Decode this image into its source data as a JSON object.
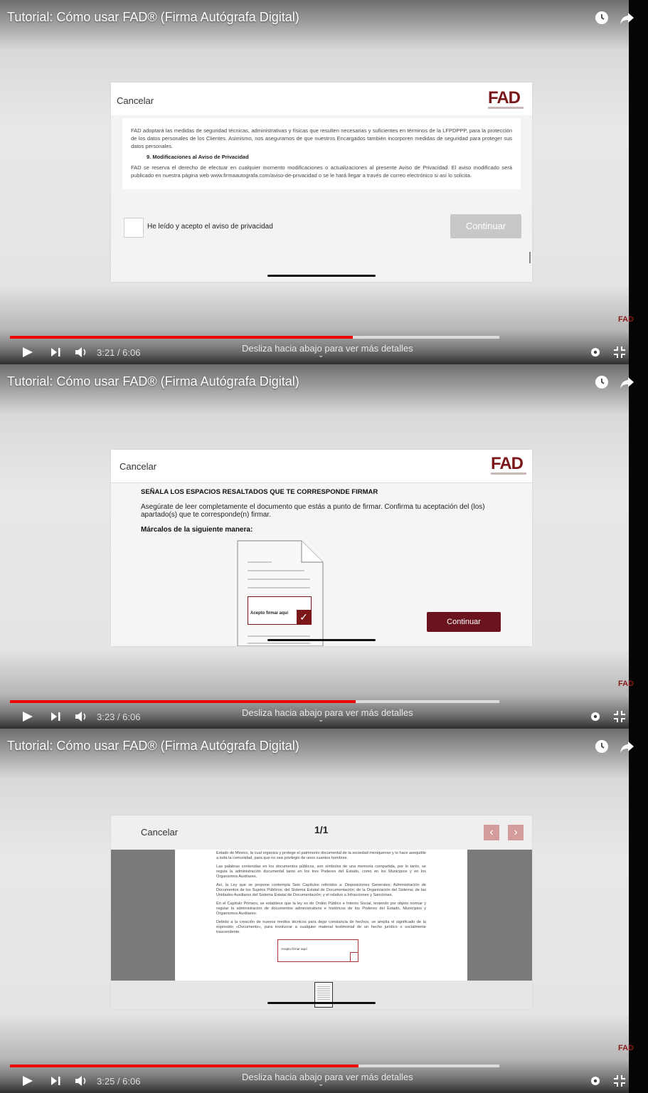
{
  "video": {
    "title": "Tutorial: Cómo usar FAD® (Firma Autógrafa Digital)",
    "watermark": "FAD",
    "hint": "Desliza hacia abajo para ver más detalles",
    "accent": "#e00000",
    "frames": [
      {
        "time": "3:21 / 6:06",
        "progress": 0.72,
        "loaded": 1.0
      },
      {
        "time": "3:23 / 6:06",
        "progress": 0.7,
        "loaded": 1.0
      },
      {
        "time": "3:25 / 6:06",
        "progress": 0.71,
        "loaded": 1.0
      }
    ]
  },
  "icons": {
    "clock": "clock-icon",
    "share": "share-icon",
    "play": "play-icon",
    "next": "next-icon",
    "volume": "volume-icon",
    "settings": "gear-icon",
    "exit_fullscreen": "exit-fullscreen-icon"
  },
  "screen1": {
    "cancel": "Cancelar",
    "logo": "FAD",
    "para1": "FAD adoptará las medidas de seguridad técnicas, administrativas y físicas que resulten necesarias y suficientes en términos de la LFPDPPP, para la protección de los datos personales de los Clientes. Asimismo, nos aseguramos de que nuestros Encargados también incorporen medidas de seguridad para proteger sus datos personales.",
    "section": "9.      Modificaciones al Aviso de Privacidad",
    "para2": "FAD se reserva el derecho de efectuar en cualquier momento modificaciones o actualizaciones al presente Aviso de Privacidad. El aviso modificado será publicado en nuestra página web www.firmaautografa.com/aviso-de-privacidad o se le hará llegar a través de correo electrónico si así lo solicita.",
    "checkbox_label": "He leído y acepto el aviso de privacidad",
    "continue": "Continuar"
  },
  "screen2": {
    "cancel": "Cancelar",
    "logo": "FAD",
    "heading": "SEÑALA LOS ESPACIOS RESALTADOS QUE TE CORRESPONDE FIRMAR",
    "body": "Asegúrate de leer completamente el documento que estás a punto de firmar. Confirma tu aceptación del (los) apartado(s) que te corresponde(n) firmar.",
    "mark_label": "Márcalos de la siguiente manera:",
    "accept_box": "Acepto firmar aquí",
    "continue": "Continuar"
  },
  "screen3": {
    "cancel": "Cancelar",
    "page": "1/1",
    "doc_paragraphs": [
      "Estado de México, la cual organiza y protege el patrimonio documental de la sociedad mexiquense y lo hace asequible a toda la comunidad, para que no sea privilegio de unos cuantos hombres.",
      "Las palabras contenidas en los documentos públicos, son símbolos de una memoria compartida, por lo tanto, se regula la administración documental tanto en los tres Poderes del Estado, como en los Municipios y en los Organismos Auxiliares.",
      "Así, la Ley que se propone contempla Seis Capítulos referidos a: Disposiciones Generales; Administración de Documentos de los Sujetos Públicos; del Sistema Estatal de Documentación; de la Organización del Sistema; de las Unidades Auxiliares del Sistema Estatal de Documentación; y el relativo a Infracciones y Sanciones.",
      "En el Capítulo Primero, se establece que la ley es de Orden Público e Interés Social, teniendo por objeto normar y regular la administración de documentos administrativos e históricos de los Poderes del Estado, Municipios y Organismos Auxiliares.",
      "Debido a la creación de nuevos medios técnicos para dejar constancia de hechos, se amplía el significado de la expresión «Documento», para involucrar a cualquier material testimonial de un hecho jurídico o socialmente trascendente."
    ],
    "sign_box": "Acepto firmar aquí"
  }
}
